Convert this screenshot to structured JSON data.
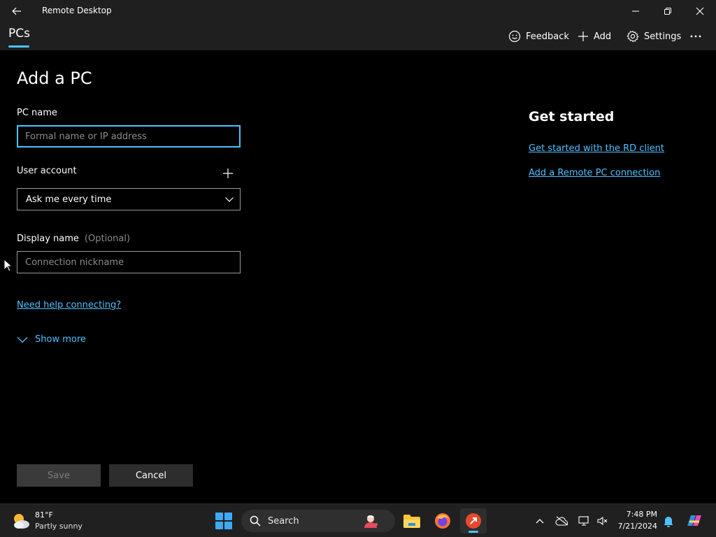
{
  "window": {
    "title": "Remote Desktop"
  },
  "header": {
    "tab_label": "PCs",
    "feedback_label": "Feedback",
    "add_label": "Add",
    "settings_label": "Settings"
  },
  "form": {
    "title": "Add a PC",
    "pc_name_label": "PC name",
    "pc_name_placeholder": "Formal name or IP address",
    "pc_name_value": "",
    "user_account_label": "User account",
    "user_account_value": "Ask me every time",
    "display_name_label": "Display name",
    "display_name_optional": "(Optional)",
    "display_name_placeholder": "Connection nickname",
    "help_link": "Need help connecting?",
    "show_more_label": "Show more",
    "save_label": "Save",
    "cancel_label": "Cancel"
  },
  "side_panel": {
    "title": "Get started",
    "links": [
      "Get started with the RD client",
      "Add a Remote PC connection"
    ]
  },
  "taskbar": {
    "weather_temp": "81°F",
    "weather_desc": "Partly sunny",
    "search_label": "Search",
    "time": "7:48 PM",
    "date": "7/21/2024"
  },
  "colors": {
    "accent": "#4cc2ff",
    "background": "#000000",
    "chrome": "#1f1f1f",
    "taskbar": "#202020"
  }
}
